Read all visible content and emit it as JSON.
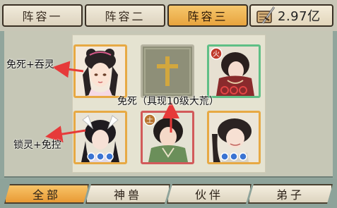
{
  "lineup_tabs": [
    {
      "label": "阵容一",
      "active": false
    },
    {
      "label": "阵容二",
      "active": false
    },
    {
      "label": "阵容三",
      "active": true
    }
  ],
  "power": {
    "value": "2.97亿",
    "icon": "sword-scroll-icon"
  },
  "annotations": {
    "top_left": "免死+吞灵",
    "center": "免死（具现10级大荒）",
    "bottom_left": "锁灵+免控"
  },
  "filter_tabs": [
    {
      "label": "全部",
      "active": true
    },
    {
      "label": "神兽",
      "active": false
    },
    {
      "label": "伙伴",
      "active": false
    },
    {
      "label": "弟子",
      "active": false
    }
  ],
  "slots": [
    {
      "id": "slot-1",
      "frame": "gold",
      "stars": 0,
      "badge": ""
    },
    {
      "id": "slot-2",
      "frame": "empty",
      "icon": "cross-icon"
    },
    {
      "id": "slot-3",
      "frame": "green",
      "stars": 3,
      "badge": "火"
    },
    {
      "id": "slot-4",
      "frame": "gold",
      "stars": 3,
      "badge": ""
    },
    {
      "id": "slot-5",
      "frame": "red",
      "stars": 0,
      "badge": "土"
    },
    {
      "id": "slot-6",
      "frame": "gold",
      "stars": 3,
      "badge": ""
    }
  ],
  "colors": {
    "gold_frame": "#e7a944",
    "green_frame": "#5fbf86",
    "red_frame": "#d25a5a",
    "arrow": "#e63a3a",
    "active_tab": "#f0b254"
  }
}
